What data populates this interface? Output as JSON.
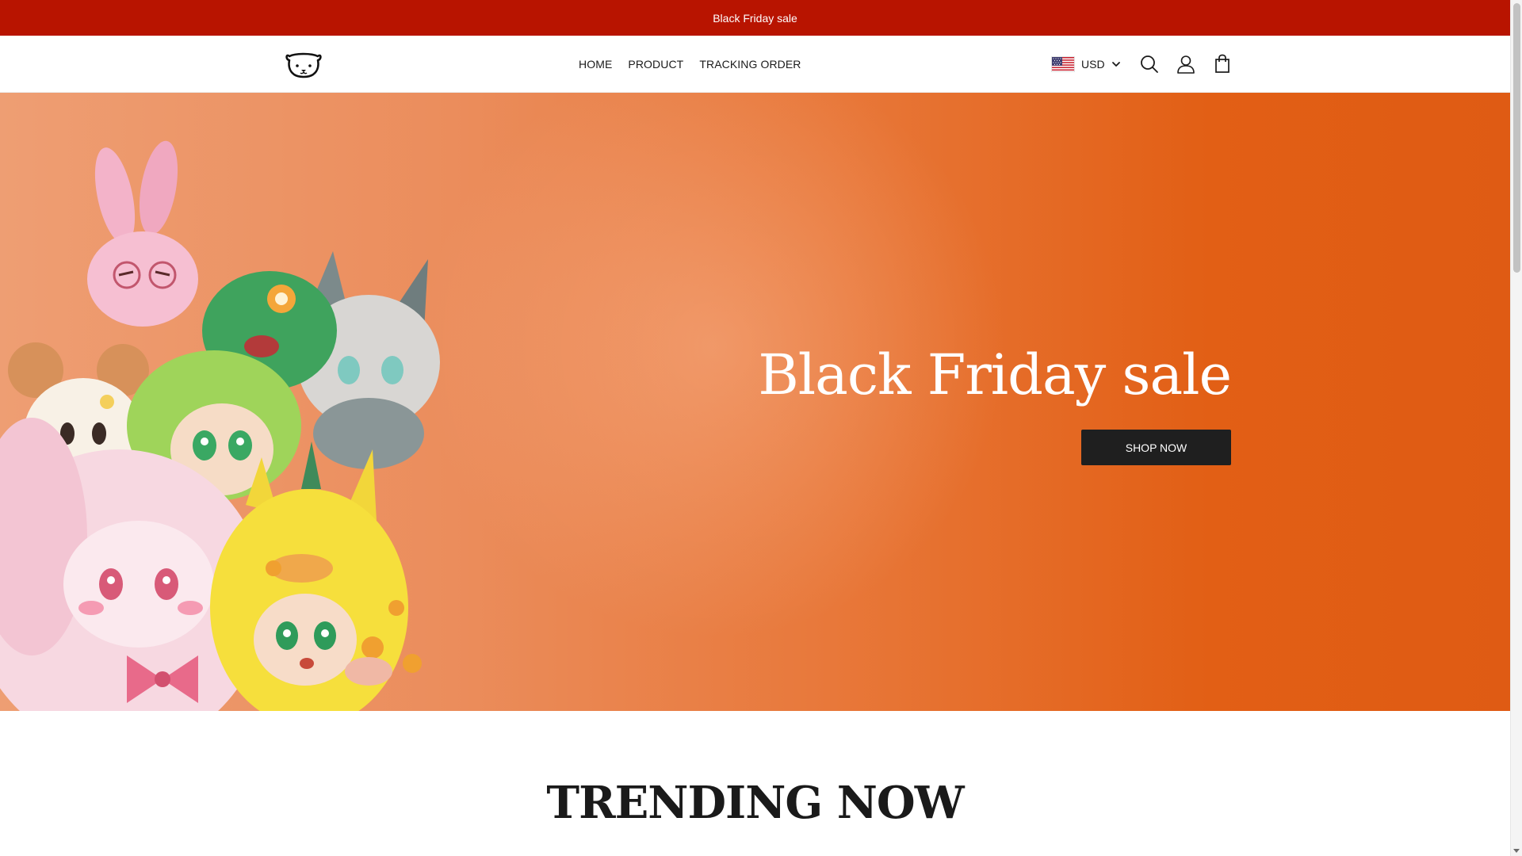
{
  "announcement": {
    "text": "Black Friday sale"
  },
  "header": {
    "logo_icon": "bear-face-icon",
    "nav": [
      {
        "label": "HOME"
      },
      {
        "label": "PRODUCT"
      },
      {
        "label": "TRACKING ORDER"
      }
    ],
    "currency": {
      "label": "USD",
      "flag_icon": "us-flag-icon"
    },
    "icons": [
      "search-icon",
      "account-icon",
      "cart-icon"
    ]
  },
  "hero": {
    "title": "Black Friday sale",
    "button_label": "SHOP NOW",
    "image_icon": "plush-toys-illustration"
  },
  "trending": {
    "title": "TRENDING NOW"
  },
  "colors": {
    "announcement_bg": "#b81400",
    "hero_gradient_start": "#ee9e73",
    "hero_gradient_end": "#df5b14",
    "button_bg": "#1f1f1f"
  }
}
